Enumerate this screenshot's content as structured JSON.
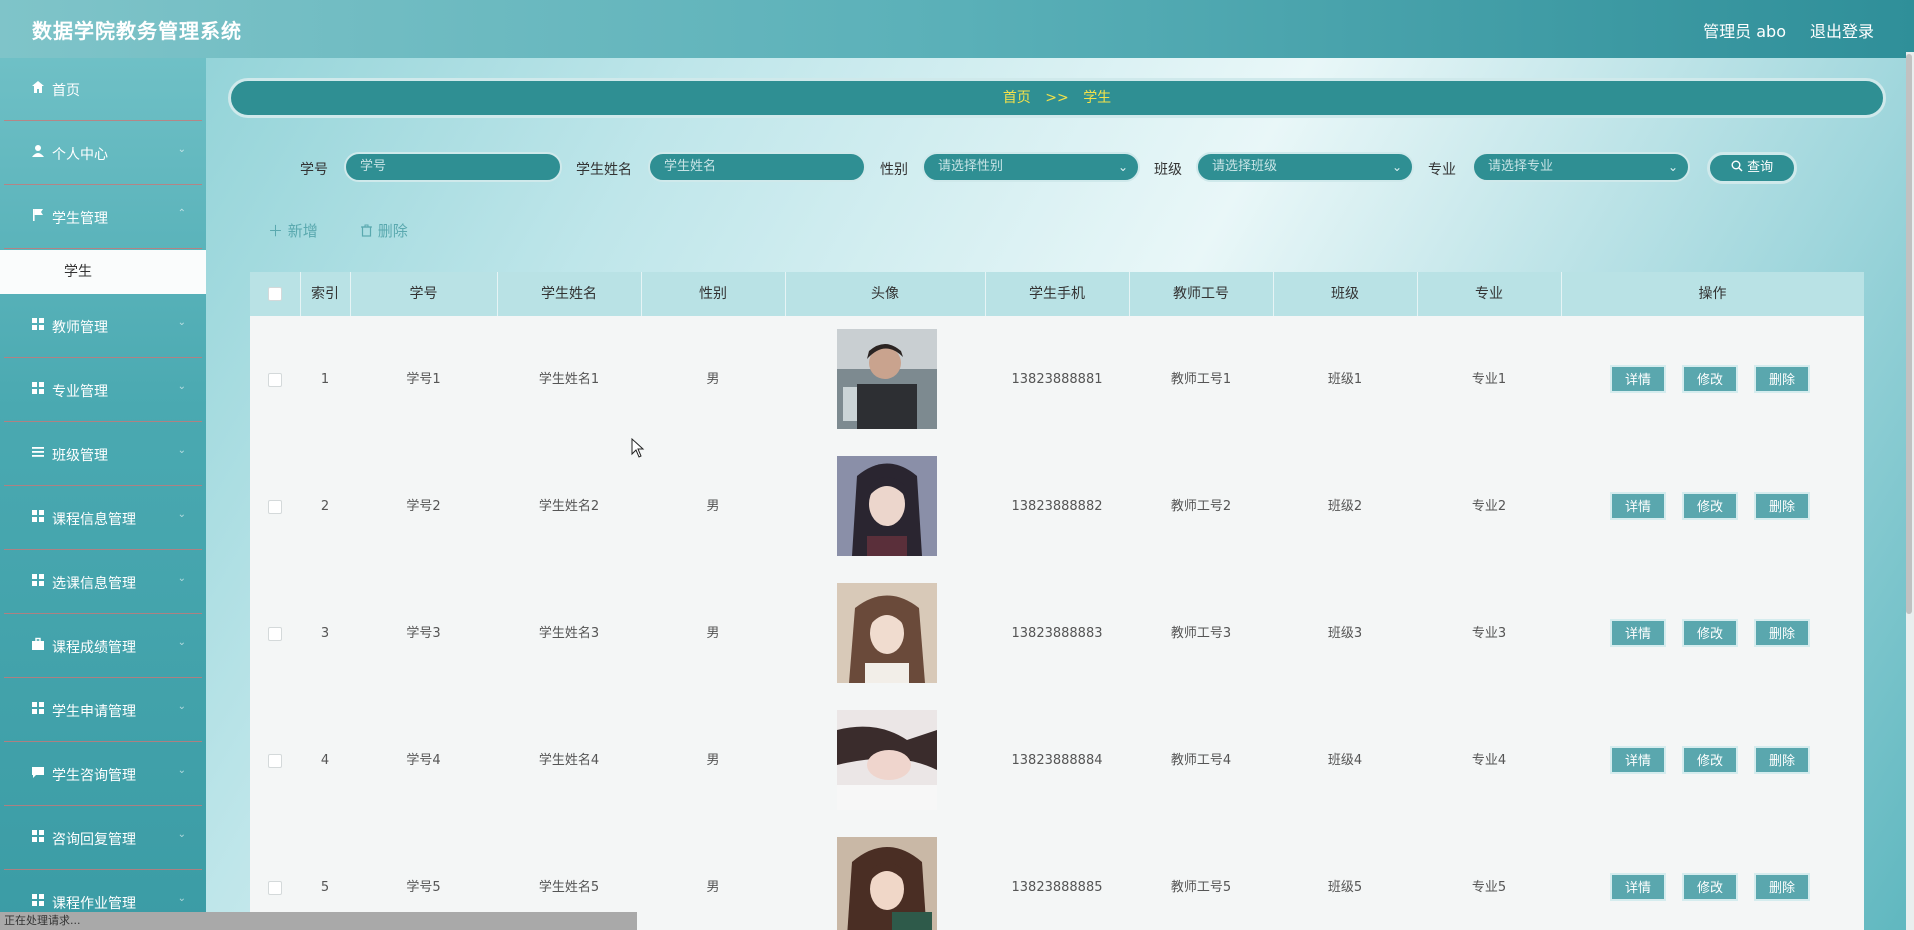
{
  "header": {
    "app_title": "数据学院教务管理系统",
    "admin_label": "管理员 abo",
    "logout_label": "退出登录"
  },
  "sidebar": {
    "items": [
      {
        "label": "首页",
        "icon": "home-icon"
      },
      {
        "label": "个人中心",
        "icon": "user-icon"
      },
      {
        "label": "学生管理",
        "icon": "flag-icon"
      },
      {
        "label": "教师管理",
        "icon": "grid-icon"
      },
      {
        "label": "专业管理",
        "icon": "grid-icon"
      },
      {
        "label": "班级管理",
        "icon": "list-icon"
      },
      {
        "label": "课程信息管理",
        "icon": "grid-icon"
      },
      {
        "label": "选课信息管理",
        "icon": "grid-icon"
      },
      {
        "label": "课程成绩管理",
        "icon": "briefcase-icon"
      },
      {
        "label": "学生申请管理",
        "icon": "grid-icon"
      },
      {
        "label": "学生咨询管理",
        "icon": "chat-icon"
      },
      {
        "label": "咨询回复管理",
        "icon": "grid-icon"
      },
      {
        "label": "课程作业管理",
        "icon": "grid-icon"
      }
    ],
    "submenu_student": "学生"
  },
  "breadcrumb": {
    "home": "首页",
    "separator": ">>",
    "current": "学生"
  },
  "search": {
    "student_no_label": "学号",
    "student_no_placeholder": "学号",
    "student_name_label": "学生姓名",
    "student_name_placeholder": "学生姓名",
    "gender_label": "性别",
    "gender_placeholder": "请选择性别",
    "class_label": "班级",
    "class_placeholder": "请选择班级",
    "major_label": "专业",
    "major_placeholder": "请选择专业",
    "query_label": "查询"
  },
  "actions": {
    "add_label": "新增",
    "delete_label": "删除"
  },
  "table": {
    "headers": [
      "索引",
      "学号",
      "学生姓名",
      "性别",
      "头像",
      "学生手机",
      "教师工号",
      "班级",
      "专业",
      "操作"
    ],
    "rows": [
      {
        "index": "1",
        "student_no": "学号1",
        "name": "学生姓名1",
        "gender": "男",
        "phone": "13823888881",
        "teacher_no": "教师工号1",
        "class": "班级1",
        "major": "专业1"
      },
      {
        "index": "2",
        "student_no": "学号2",
        "name": "学生姓名2",
        "gender": "男",
        "phone": "13823888882",
        "teacher_no": "教师工号2",
        "class": "班级2",
        "major": "专业2"
      },
      {
        "index": "3",
        "student_no": "学号3",
        "name": "学生姓名3",
        "gender": "男",
        "phone": "13823888883",
        "teacher_no": "教师工号3",
        "class": "班级3",
        "major": "专业3"
      },
      {
        "index": "4",
        "student_no": "学号4",
        "name": "学生姓名4",
        "gender": "男",
        "phone": "13823888884",
        "teacher_no": "教师工号4",
        "class": "班级4",
        "major": "专业4"
      },
      {
        "index": "5",
        "student_no": "学号5",
        "name": "学生姓名5",
        "gender": "男",
        "phone": "13823888885",
        "teacher_no": "教师工号5",
        "class": "班级5",
        "major": "专业5"
      }
    ],
    "op_detail": "详情",
    "op_edit": "修改",
    "op_delete": "删除"
  },
  "status_text": "正在处理请求...",
  "colors": {
    "accent": "#2f8f93",
    "breadcrumb_text": "#f4e24a",
    "button": "#5aa7ae",
    "table_header": "#b9e2e5"
  }
}
